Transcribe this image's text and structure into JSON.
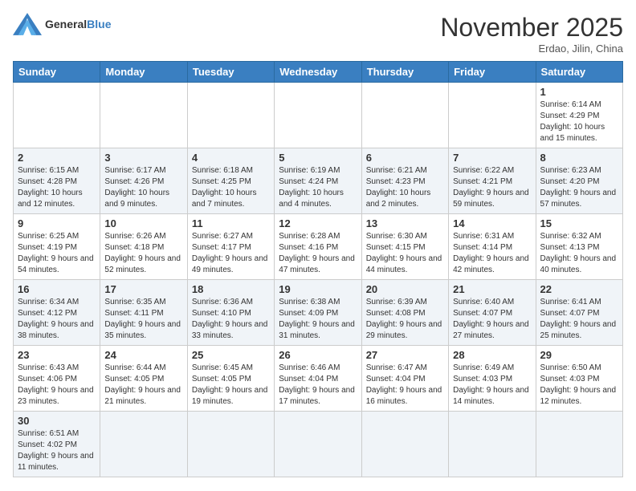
{
  "logo": {
    "text_general": "General",
    "text_blue": "Blue"
  },
  "title": "November 2025",
  "subtitle": "Erdao, Jilin, China",
  "weekdays": [
    "Sunday",
    "Monday",
    "Tuesday",
    "Wednesday",
    "Thursday",
    "Friday",
    "Saturday"
  ],
  "weeks": [
    [
      {
        "day": "",
        "info": ""
      },
      {
        "day": "",
        "info": ""
      },
      {
        "day": "",
        "info": ""
      },
      {
        "day": "",
        "info": ""
      },
      {
        "day": "",
        "info": ""
      },
      {
        "day": "",
        "info": ""
      },
      {
        "day": "1",
        "info": "Sunrise: 6:14 AM\nSunset: 4:29 PM\nDaylight: 10 hours and 15 minutes."
      }
    ],
    [
      {
        "day": "2",
        "info": "Sunrise: 6:15 AM\nSunset: 4:28 PM\nDaylight: 10 hours and 12 minutes."
      },
      {
        "day": "3",
        "info": "Sunrise: 6:17 AM\nSunset: 4:26 PM\nDaylight: 10 hours and 9 minutes."
      },
      {
        "day": "4",
        "info": "Sunrise: 6:18 AM\nSunset: 4:25 PM\nDaylight: 10 hours and 7 minutes."
      },
      {
        "day": "5",
        "info": "Sunrise: 6:19 AM\nSunset: 4:24 PM\nDaylight: 10 hours and 4 minutes."
      },
      {
        "day": "6",
        "info": "Sunrise: 6:21 AM\nSunset: 4:23 PM\nDaylight: 10 hours and 2 minutes."
      },
      {
        "day": "7",
        "info": "Sunrise: 6:22 AM\nSunset: 4:21 PM\nDaylight: 9 hours and 59 minutes."
      },
      {
        "day": "8",
        "info": "Sunrise: 6:23 AM\nSunset: 4:20 PM\nDaylight: 9 hours and 57 minutes."
      }
    ],
    [
      {
        "day": "9",
        "info": "Sunrise: 6:25 AM\nSunset: 4:19 PM\nDaylight: 9 hours and 54 minutes."
      },
      {
        "day": "10",
        "info": "Sunrise: 6:26 AM\nSunset: 4:18 PM\nDaylight: 9 hours and 52 minutes."
      },
      {
        "day": "11",
        "info": "Sunrise: 6:27 AM\nSunset: 4:17 PM\nDaylight: 9 hours and 49 minutes."
      },
      {
        "day": "12",
        "info": "Sunrise: 6:28 AM\nSunset: 4:16 PM\nDaylight: 9 hours and 47 minutes."
      },
      {
        "day": "13",
        "info": "Sunrise: 6:30 AM\nSunset: 4:15 PM\nDaylight: 9 hours and 44 minutes."
      },
      {
        "day": "14",
        "info": "Sunrise: 6:31 AM\nSunset: 4:14 PM\nDaylight: 9 hours and 42 minutes."
      },
      {
        "day": "15",
        "info": "Sunrise: 6:32 AM\nSunset: 4:13 PM\nDaylight: 9 hours and 40 minutes."
      }
    ],
    [
      {
        "day": "16",
        "info": "Sunrise: 6:34 AM\nSunset: 4:12 PM\nDaylight: 9 hours and 38 minutes."
      },
      {
        "day": "17",
        "info": "Sunrise: 6:35 AM\nSunset: 4:11 PM\nDaylight: 9 hours and 35 minutes."
      },
      {
        "day": "18",
        "info": "Sunrise: 6:36 AM\nSunset: 4:10 PM\nDaylight: 9 hours and 33 minutes."
      },
      {
        "day": "19",
        "info": "Sunrise: 6:38 AM\nSunset: 4:09 PM\nDaylight: 9 hours and 31 minutes."
      },
      {
        "day": "20",
        "info": "Sunrise: 6:39 AM\nSunset: 4:08 PM\nDaylight: 9 hours and 29 minutes."
      },
      {
        "day": "21",
        "info": "Sunrise: 6:40 AM\nSunset: 4:07 PM\nDaylight: 9 hours and 27 minutes."
      },
      {
        "day": "22",
        "info": "Sunrise: 6:41 AM\nSunset: 4:07 PM\nDaylight: 9 hours and 25 minutes."
      }
    ],
    [
      {
        "day": "23",
        "info": "Sunrise: 6:43 AM\nSunset: 4:06 PM\nDaylight: 9 hours and 23 minutes."
      },
      {
        "day": "24",
        "info": "Sunrise: 6:44 AM\nSunset: 4:05 PM\nDaylight: 9 hours and 21 minutes."
      },
      {
        "day": "25",
        "info": "Sunrise: 6:45 AM\nSunset: 4:05 PM\nDaylight: 9 hours and 19 minutes."
      },
      {
        "day": "26",
        "info": "Sunrise: 6:46 AM\nSunset: 4:04 PM\nDaylight: 9 hours and 17 minutes."
      },
      {
        "day": "27",
        "info": "Sunrise: 6:47 AM\nSunset: 4:04 PM\nDaylight: 9 hours and 16 minutes."
      },
      {
        "day": "28",
        "info": "Sunrise: 6:49 AM\nSunset: 4:03 PM\nDaylight: 9 hours and 14 minutes."
      },
      {
        "day": "29",
        "info": "Sunrise: 6:50 AM\nSunset: 4:03 PM\nDaylight: 9 hours and 12 minutes."
      }
    ],
    [
      {
        "day": "30",
        "info": "Sunrise: 6:51 AM\nSunset: 4:02 PM\nDaylight: 9 hours and 11 minutes."
      },
      {
        "day": "",
        "info": ""
      },
      {
        "day": "",
        "info": ""
      },
      {
        "day": "",
        "info": ""
      },
      {
        "day": "",
        "info": ""
      },
      {
        "day": "",
        "info": ""
      },
      {
        "day": "",
        "info": ""
      }
    ]
  ]
}
